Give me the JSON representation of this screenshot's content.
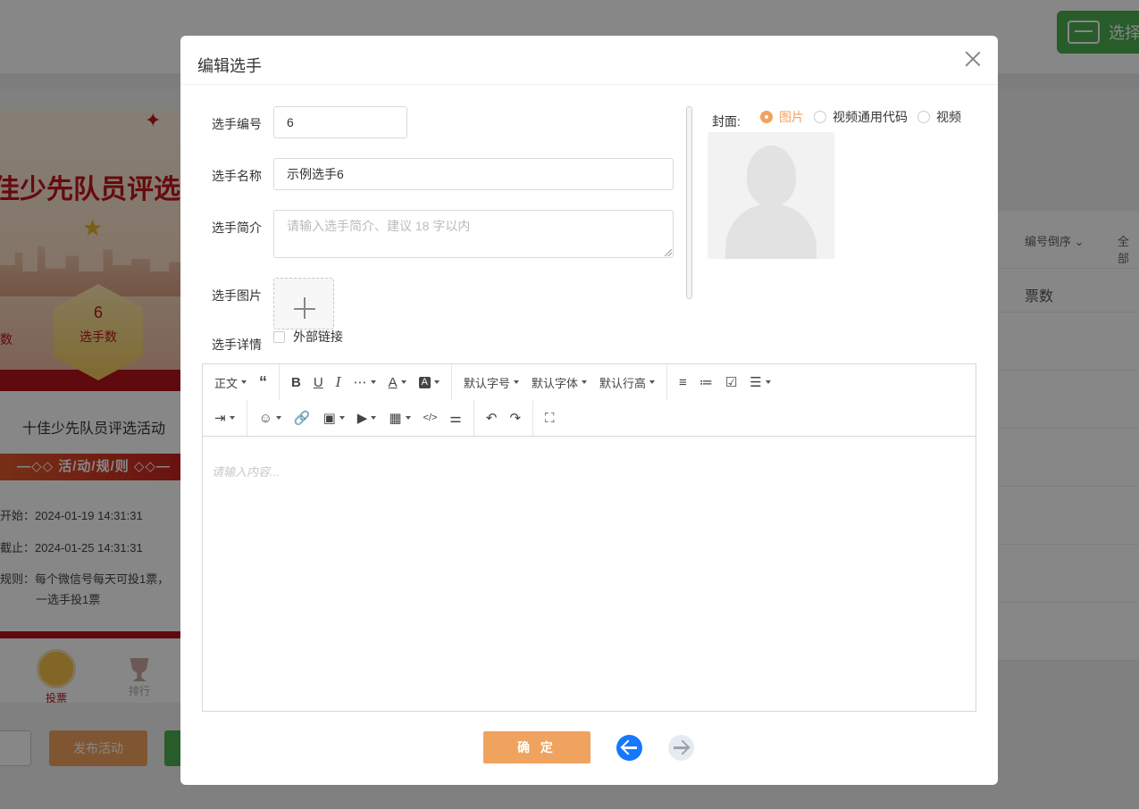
{
  "background": {
    "select_button": "选择",
    "phone": {
      "poster_title": "佳少先队员评选活",
      "stat_count": "6",
      "stat_label": "选手数",
      "stat_left_label": "数",
      "activity_name": "十佳少先队员评选活动",
      "rules_title": "—◇◇ 活/动/规/则 ◇◇—",
      "start_time": "开始：2024-01-19 14:31:31",
      "end_time": "截止：2024-01-25 14:31:31",
      "rule_line1": "规则：每个微信号每天可投1票，",
      "rule_line2": "一选手投1票",
      "tab_vote": "投票",
      "tab_rank": "排行"
    },
    "publish_button": "发布活动",
    "right_panel": {
      "sort_label": "编号倒序",
      "all_label": "全部",
      "votes_header": "票数"
    }
  },
  "modal": {
    "title": "编辑选手",
    "fields": {
      "number_label": "选手编号",
      "number_value": "6",
      "name_label": "选手名称",
      "name_value": "示例选手6",
      "intro_label": "选手简介",
      "intro_placeholder": "请输入选手简介、建议 18 字以内",
      "image_label": "选手图片",
      "detail_label": "选手详情",
      "external_link_label": "外部链接"
    },
    "cover": {
      "label": "封面:",
      "options": [
        "图片",
        "视频通用代码",
        "视频"
      ],
      "selected": "图片",
      "accent_color": "#f0a35e"
    },
    "editor": {
      "toolbar_row1": {
        "paragraph": "正文",
        "font_size": "默认字号",
        "font_family": "默认字体",
        "line_height": "默认行高"
      },
      "placeholder": "请输入内容..."
    },
    "confirm_button": "确 定",
    "nav_prev_color": "#1677ff"
  }
}
